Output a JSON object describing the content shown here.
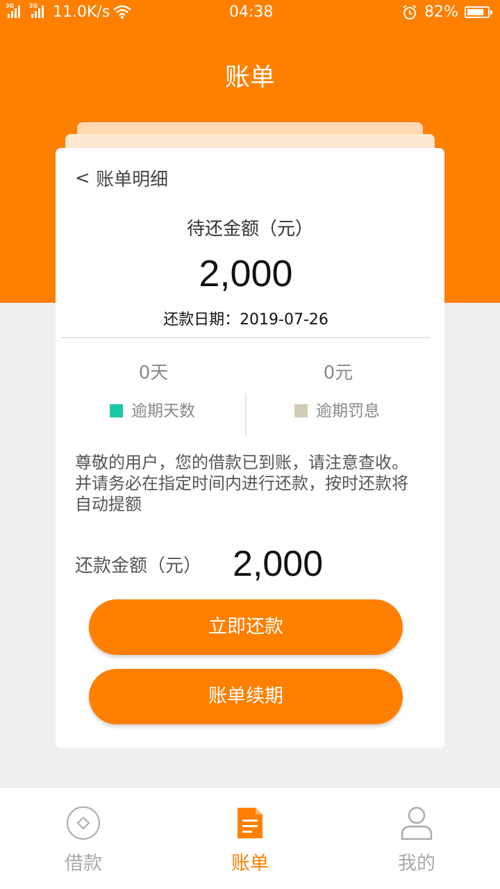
{
  "status_bar": {
    "net1": "3G",
    "net2": "2G",
    "speed": "11.0K/s",
    "time": "04:38",
    "battery_pct": "82%",
    "battery_level": 0.82
  },
  "header": {
    "title": "账单"
  },
  "card": {
    "back_label": "账单明细",
    "due_label": "待还金额（元）",
    "due_amount": "2,000",
    "due_date": "还款日期：2019-07-26",
    "overdue_days_value": "0天",
    "overdue_days_label": "逾期天数",
    "overdue_fine_value": "0元",
    "overdue_fine_label": "逾期罚息",
    "notice": "尊敬的用户，您的借款已到账，请注意查收。并请务必在指定时间内进行还款，按时还款将自动提额",
    "repay_label": "还款金额（元）",
    "repay_amount": "2,000",
    "repay_button": "立即还款",
    "renew_button": "账单续期"
  },
  "tabs": [
    {
      "label": "借款",
      "icon": "loan-icon",
      "active": false
    },
    {
      "label": "账单",
      "icon": "bill-icon",
      "active": true
    },
    {
      "label": "我的",
      "icon": "user-icon",
      "active": false
    }
  ],
  "colors": {
    "accent": "#ff7f00",
    "overdue_days_marker": "#1ac8a4",
    "overdue_fine_marker": "#d2ccb4",
    "tab_inactive": "#aaaaaa"
  }
}
